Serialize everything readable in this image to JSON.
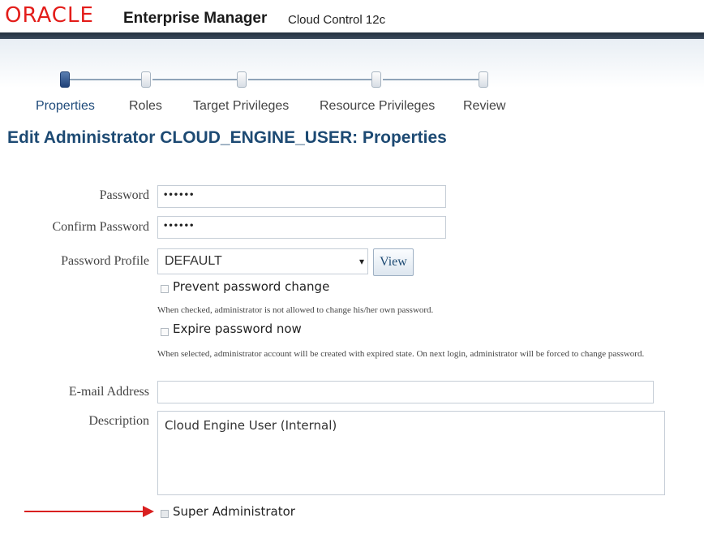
{
  "header": {
    "logo_text": "ORACLE",
    "product_name": "Enterprise Manager",
    "product_sub": "Cloud Control 12c",
    "accent_color": "#e31d1a"
  },
  "train": {
    "steps": [
      {
        "label": "Properties",
        "current": true
      },
      {
        "label": "Roles",
        "current": false
      },
      {
        "label": "Target Privileges",
        "current": false
      },
      {
        "label": "Resource Privileges",
        "current": false
      },
      {
        "label": "Review",
        "current": false
      }
    ]
  },
  "page": {
    "title": "Edit Administrator CLOUD_ENGINE_USER: Properties"
  },
  "form": {
    "password_label": "Password",
    "password_value": "••••••",
    "confirm_password_label": "Confirm Password",
    "confirm_password_value": "••••••",
    "password_profile_label": "Password Profile",
    "password_profile_value": "DEFAULT",
    "view_button": "View",
    "prevent_change_label": "Prevent password change",
    "prevent_change_checked": false,
    "prevent_change_hint": "When checked, administrator is not allowed to change his/her own password.",
    "expire_label": "Expire password now",
    "expire_checked": false,
    "expire_hint": "When selected, administrator account will be created with expired state. On next login, administrator will be forced to change password.",
    "email_label": "E-mail Address",
    "email_value": "",
    "description_label": "Description",
    "description_value": "Cloud Engine User (Internal)",
    "super_admin_label": "Super Administrator",
    "super_admin_checked": true
  }
}
